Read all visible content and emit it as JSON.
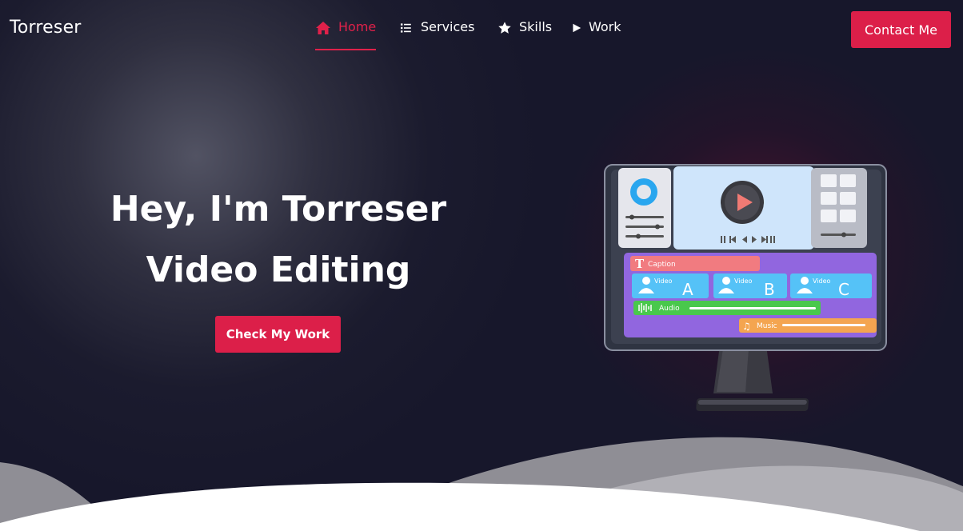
{
  "brand": {
    "logo_text": "Torreser"
  },
  "nav": {
    "items": [
      {
        "label": "Home",
        "icon": "home-icon",
        "active": true
      },
      {
        "label": "Services",
        "icon": "list-icon",
        "active": false
      },
      {
        "label": "Skills",
        "icon": "star-icon",
        "active": false
      },
      {
        "label": "Work",
        "icon": "play-icon",
        "active": false
      }
    ],
    "contact_label": "Contact Me"
  },
  "hero": {
    "title_line1": "Hey, I'm Torreser",
    "title_line2": "Video Editing",
    "cta_label": "Check My Work"
  },
  "illustration": {
    "caption_label": "Caption",
    "video_label": "Video",
    "clips": [
      "A",
      "B",
      "C"
    ],
    "audio_label": "Audio",
    "music_label": "Music"
  },
  "colors": {
    "accent": "#dc1f49",
    "background": "#17172b",
    "text": "#ffffff"
  }
}
